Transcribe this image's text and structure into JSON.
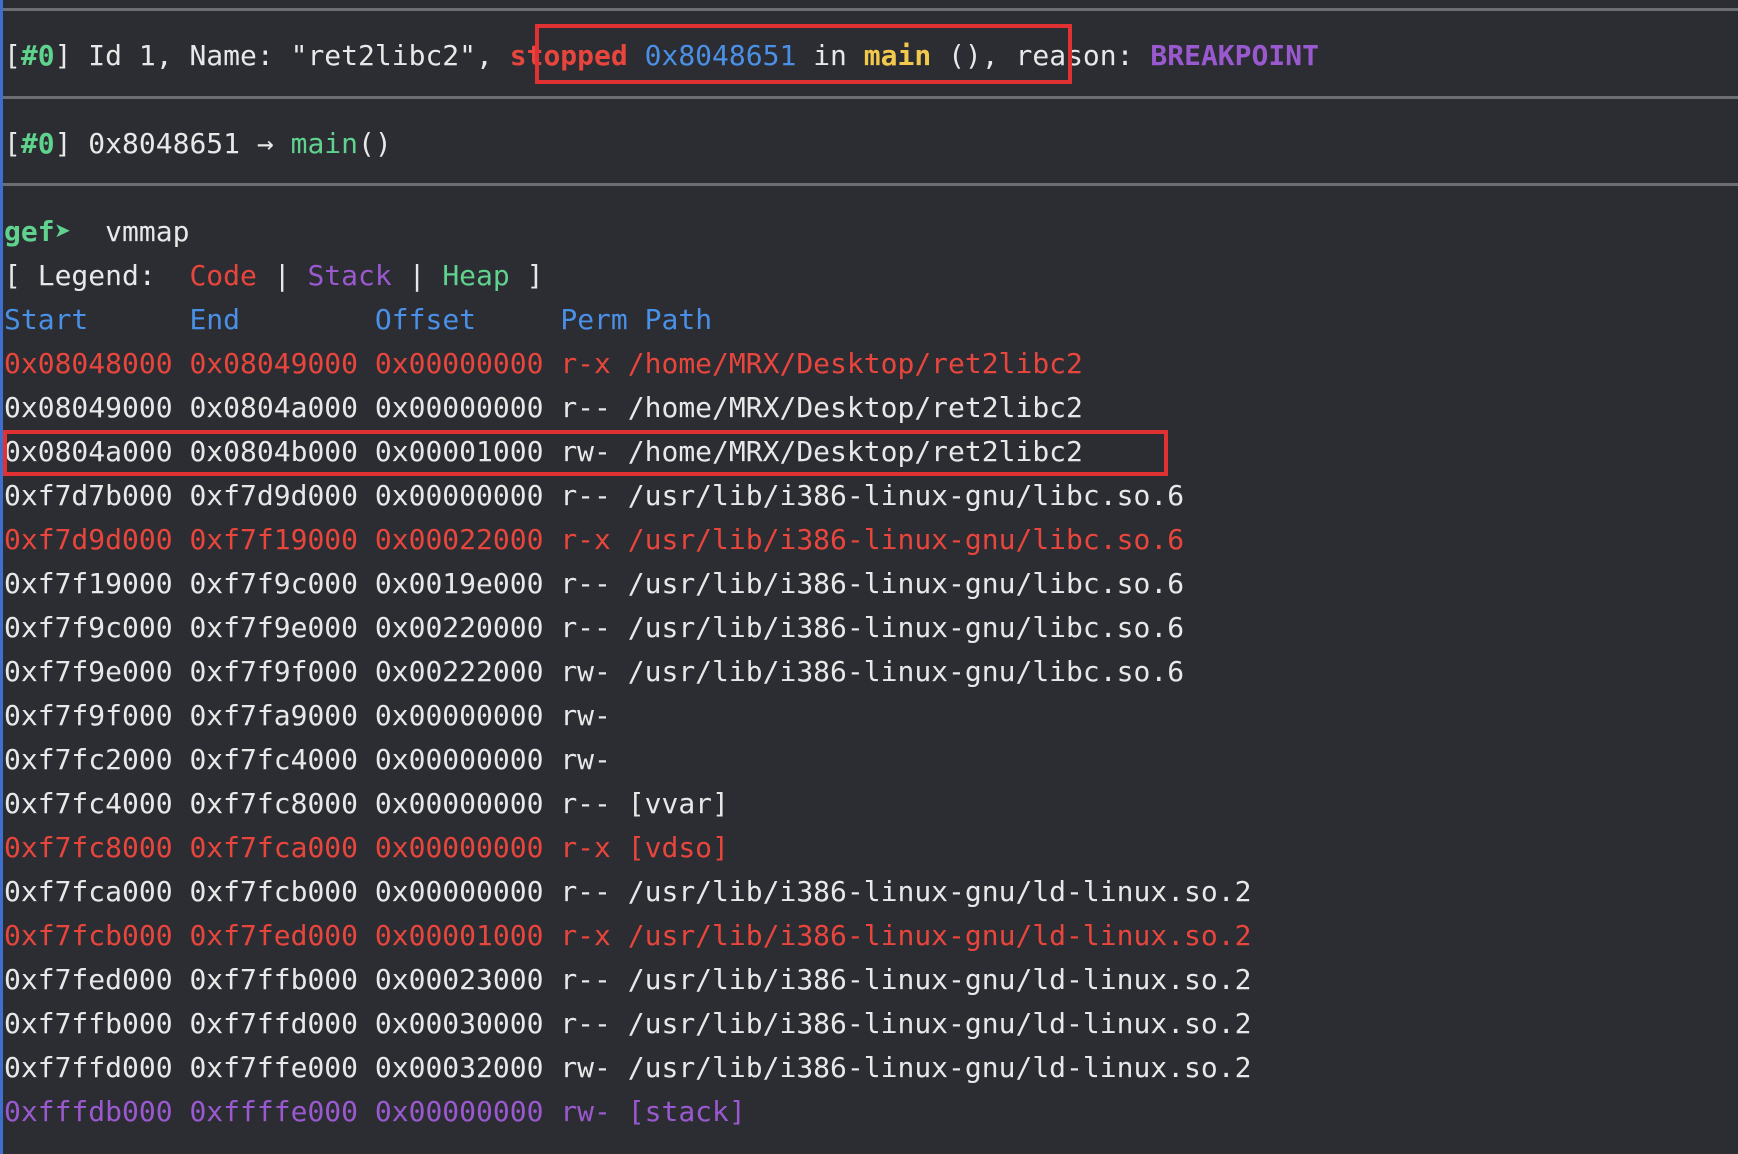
{
  "thread": {
    "num": "#0",
    "prefix": "Id 1, Name: \"ret2libc2\", ",
    "stopped": "stopped",
    "addr": "0x8048651",
    "in": "in",
    "func": "main",
    "parens": "(),",
    "reason_label": "reason:",
    "reason": "BREAKPOINT"
  },
  "trace": {
    "num": "#0",
    "addr": "0x8048651",
    "arrow": "→",
    "func": "main",
    "parens": "()"
  },
  "prompt": {
    "label": "gef➤",
    "command": "vmmap"
  },
  "legend": {
    "open": "[ Legend:",
    "code": "Code",
    "sep1": "|",
    "stack": "Stack",
    "sep2": "|",
    "heap": "Heap",
    "close": "]"
  },
  "table": {
    "headers": [
      "Start",
      "End",
      "Offset",
      "Perm",
      "Path"
    ],
    "rows": [
      {
        "start": "0x08048000",
        "end": "0x08049000",
        "offset": "0x00000000",
        "perm": "r-x",
        "path": "/home/MRX/Desktop/ret2libc2",
        "kind": "code"
      },
      {
        "start": "0x08049000",
        "end": "0x0804a000",
        "offset": "0x00000000",
        "perm": "r--",
        "path": "/home/MRX/Desktop/ret2libc2",
        "kind": "plain"
      },
      {
        "start": "0x0804a000",
        "end": "0x0804b000",
        "offset": "0x00001000",
        "perm": "rw-",
        "path": "/home/MRX/Desktop/ret2libc2",
        "kind": "plain"
      },
      {
        "start": "0xf7d7b000",
        "end": "0xf7d9d000",
        "offset": "0x00000000",
        "perm": "r--",
        "path": "/usr/lib/i386-linux-gnu/libc.so.6",
        "kind": "plain"
      },
      {
        "start": "0xf7d9d000",
        "end": "0xf7f19000",
        "offset": "0x00022000",
        "perm": "r-x",
        "path": "/usr/lib/i386-linux-gnu/libc.so.6",
        "kind": "code"
      },
      {
        "start": "0xf7f19000",
        "end": "0xf7f9c000",
        "offset": "0x0019e000",
        "perm": "r--",
        "path": "/usr/lib/i386-linux-gnu/libc.so.6",
        "kind": "plain"
      },
      {
        "start": "0xf7f9c000",
        "end": "0xf7f9e000",
        "offset": "0x00220000",
        "perm": "r--",
        "path": "/usr/lib/i386-linux-gnu/libc.so.6",
        "kind": "plain"
      },
      {
        "start": "0xf7f9e000",
        "end": "0xf7f9f000",
        "offset": "0x00222000",
        "perm": "rw-",
        "path": "/usr/lib/i386-linux-gnu/libc.so.6",
        "kind": "plain"
      },
      {
        "start": "0xf7f9f000",
        "end": "0xf7fa9000",
        "offset": "0x00000000",
        "perm": "rw-",
        "path": "",
        "kind": "plain"
      },
      {
        "start": "0xf7fc2000",
        "end": "0xf7fc4000",
        "offset": "0x00000000",
        "perm": "rw-",
        "path": "",
        "kind": "plain"
      },
      {
        "start": "0xf7fc4000",
        "end": "0xf7fc8000",
        "offset": "0x00000000",
        "perm": "r--",
        "path": "[vvar]",
        "kind": "plain"
      },
      {
        "start": "0xf7fc8000",
        "end": "0xf7fca000",
        "offset": "0x00000000",
        "perm": "r-x",
        "path": "[vdso]",
        "kind": "code"
      },
      {
        "start": "0xf7fca000",
        "end": "0xf7fcb000",
        "offset": "0x00000000",
        "perm": "r--",
        "path": "/usr/lib/i386-linux-gnu/ld-linux.so.2",
        "kind": "plain"
      },
      {
        "start": "0xf7fcb000",
        "end": "0xf7fed000",
        "offset": "0x00001000",
        "perm": "r-x",
        "path": "/usr/lib/i386-linux-gnu/ld-linux.so.2",
        "kind": "code"
      },
      {
        "start": "0xf7fed000",
        "end": "0xf7ffb000",
        "offset": "0x00023000",
        "perm": "r--",
        "path": "/usr/lib/i386-linux-gnu/ld-linux.so.2",
        "kind": "plain"
      },
      {
        "start": "0xf7ffb000",
        "end": "0xf7ffd000",
        "offset": "0x00030000",
        "perm": "r--",
        "path": "/usr/lib/i386-linux-gnu/ld-linux.so.2",
        "kind": "plain"
      },
      {
        "start": "0xf7ffd000",
        "end": "0xf7ffe000",
        "offset": "0x00032000",
        "perm": "rw-",
        "path": "/usr/lib/i386-linux-gnu/ld-linux.so.2",
        "kind": "plain"
      },
      {
        "start": "0xfffdb000",
        "end": "0xffffe000",
        "offset": "0x00000000",
        "perm": "rw-",
        "path": "[stack]",
        "kind": "stack"
      }
    ]
  },
  "colors": {
    "background": "#2b2d33",
    "code": "#e8453c",
    "stack": "#9b59d0",
    "heap": "#5fd38d",
    "header": "#4a90e6",
    "highlight_box": "#e03232"
  }
}
